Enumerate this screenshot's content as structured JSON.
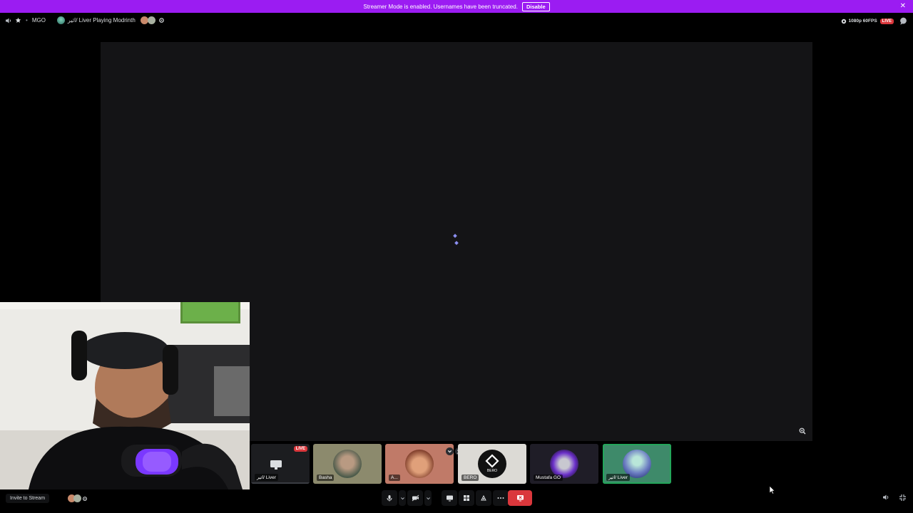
{
  "banner": {
    "message": "Streamer Mode is enabled. Usernames have been truncated.",
    "disable_label": "Disable",
    "close_symbol": "✕"
  },
  "header": {
    "server_name": "MGO",
    "stream_title": "اثير/ Liver Playing Modrinth",
    "quality": "1080p 60FPS",
    "live_label": "LIVE"
  },
  "strip": {
    "tiles": [
      {
        "name": "اثير/ Liver",
        "live": "LIVE"
      },
      {
        "name": "Basha"
      },
      {
        "name": "A..."
      },
      {
        "name": "BERO",
        "logo_text": "BERO"
      },
      {
        "name": "Mustafa GO"
      },
      {
        "name": "اثير/ Liver"
      }
    ]
  },
  "footer": {
    "invite_label": "Invite to Stream"
  },
  "colors": {
    "banner": "#9b1cf2",
    "live": "#da373c",
    "leave": "#da373c",
    "stream_bg": "#141416",
    "spinner": "#8c8ff2"
  }
}
